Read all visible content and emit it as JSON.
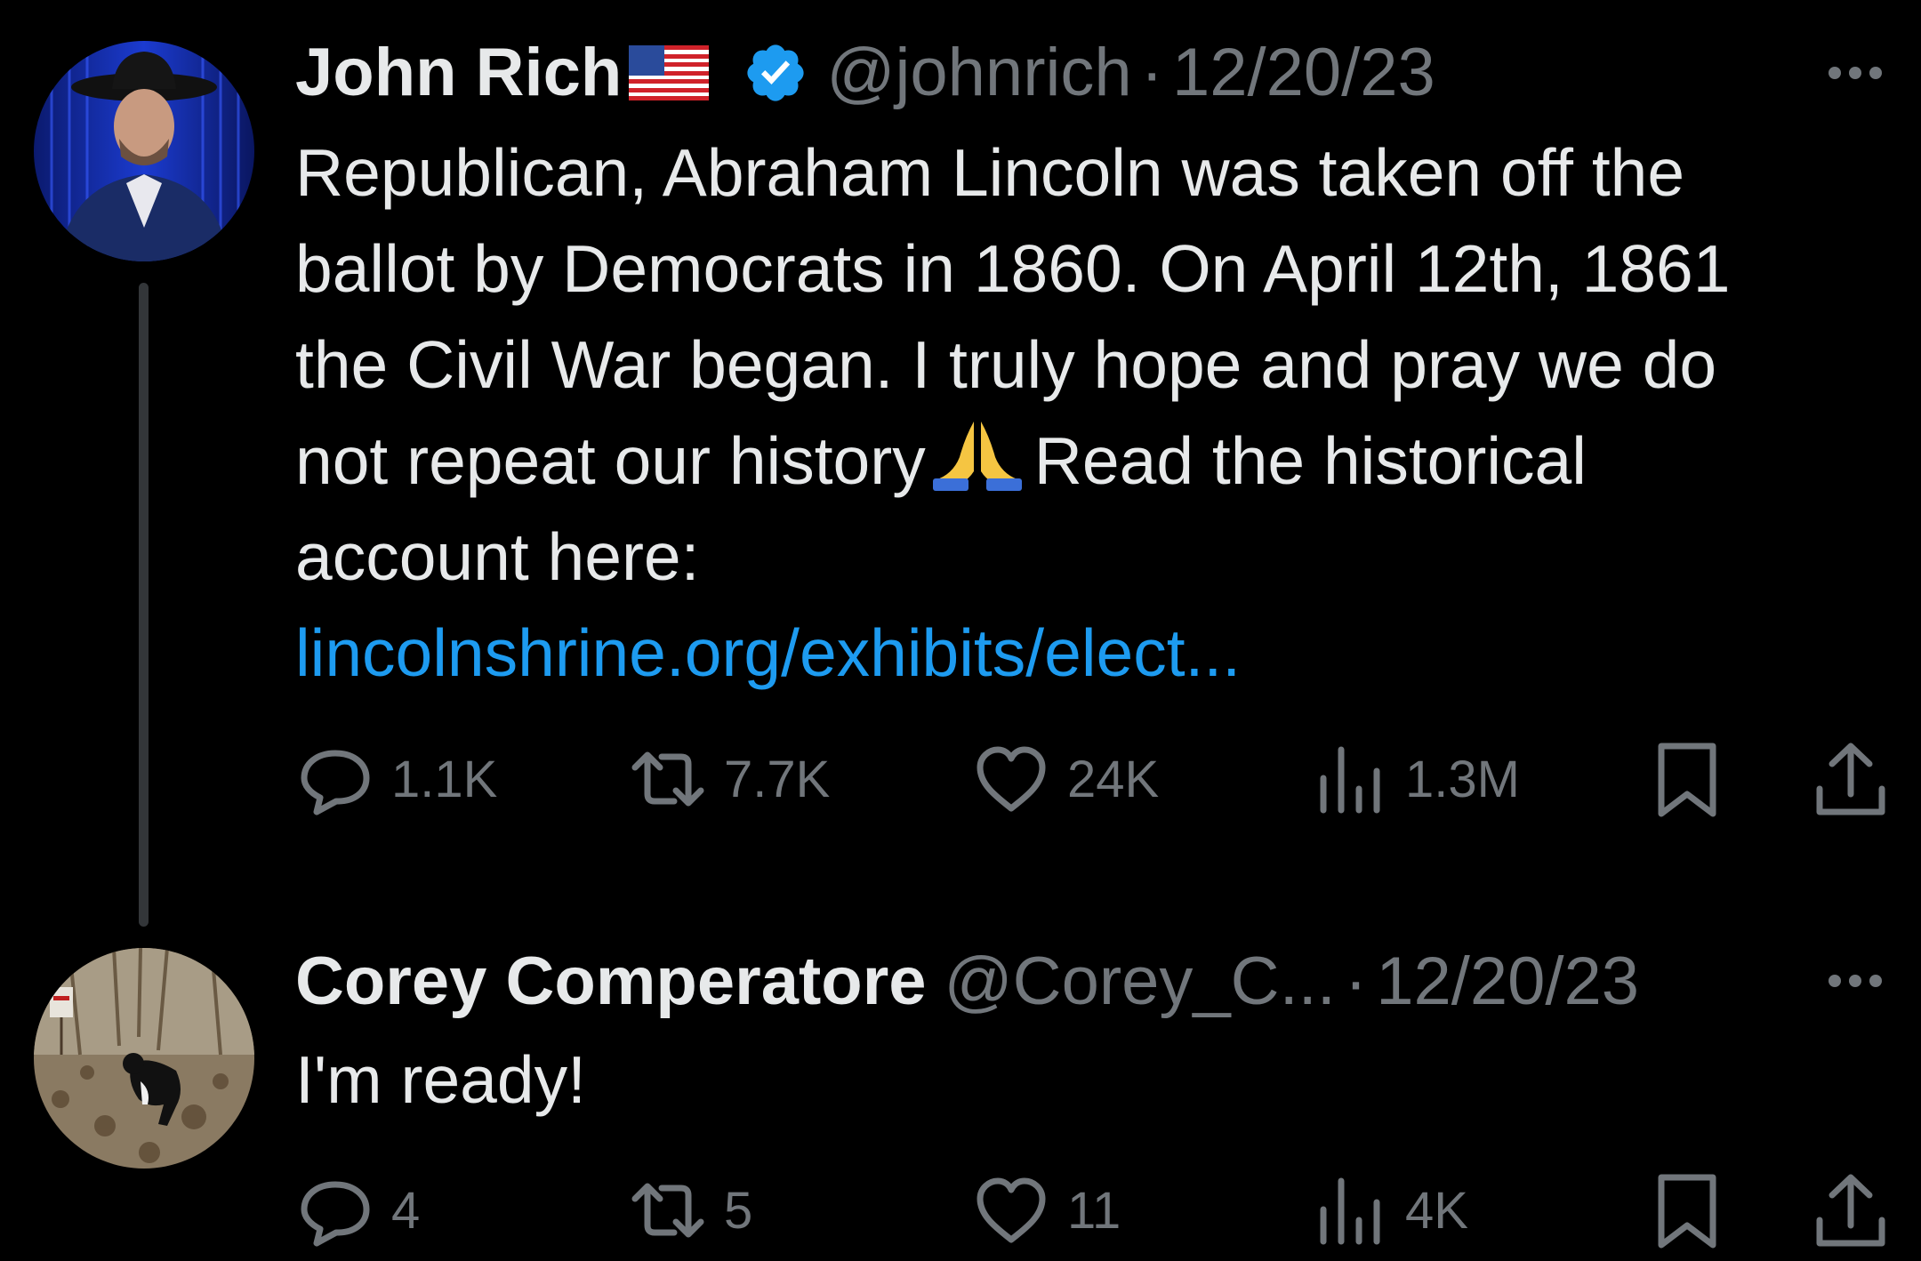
{
  "thread": [
    {
      "author_name": "John Rich",
      "author_flag": "🇺🇸",
      "verified": true,
      "handle": "@johnrich",
      "separator": "·",
      "date": "12/20/23",
      "text_lines": [
        "Republican, Abraham Lincoln was taken off the",
        "ballot by Democrats in 1860. On April 12th, 1861",
        "the Civil War began.  I truly hope and pray we do"
      ],
      "text_line4_before_emoji": "not repeat our history",
      "emoji": "🙏",
      "text_line4_after_emoji": "Read the historical",
      "text_line5": "account here:",
      "link_text": "lincolnshrine.org/exhibits/elect...",
      "stats": {
        "replies": "1.1K",
        "reposts": "7.7K",
        "likes": "24K",
        "views": "1.3M"
      }
    },
    {
      "author_name": "Corey Comperatore",
      "handle": "@Corey_C...",
      "separator": "·",
      "date": "12/20/23",
      "text": "I'm ready!",
      "stats": {
        "replies": "4",
        "reposts": "5",
        "likes": "11",
        "views": "4K"
      }
    }
  ],
  "colors": {
    "background": "#000000",
    "text_primary": "#e7e9ea",
    "text_secondary": "#71767b",
    "link": "#1d9bf0",
    "verified": "#1d9bf0",
    "thread_line": "#333639"
  },
  "icons": [
    "reply-icon",
    "repost-icon",
    "like-icon",
    "views-icon",
    "bookmark-icon",
    "share-icon",
    "more-icon",
    "verified-icon"
  ]
}
